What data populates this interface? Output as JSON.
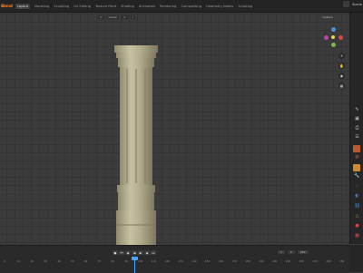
{
  "topbar": {
    "logo_label": "Blend",
    "tabs": [
      "Layout",
      "Modeling",
      "Sculpting",
      "UV Editing",
      "Texture Paint",
      "Shading",
      "Animation",
      "Rendering",
      "Compositing",
      "Geometry Nodes",
      "Scripting"
    ],
    "active_tab_index": 0,
    "scene_label": "Scene"
  },
  "viewport_header": {
    "mode_label": "Global",
    "options_label": "Options"
  },
  "timeline": {
    "ruler_ticks": [
      "0",
      "10",
      "20",
      "30",
      "40",
      "50",
      "60",
      "70",
      "80",
      "90",
      "100",
      "110",
      "120",
      "130",
      "140",
      "150",
      "160",
      "170",
      "180",
      "190",
      "200",
      "210",
      "220",
      "230",
      "240",
      "250"
    ],
    "start_label": "1",
    "end_label": "250",
    "current_frame_label": "1"
  },
  "colors": {
    "x_axis": "#e04343",
    "y_axis": "#7ab84a",
    "z_axis": "#4a8fe0",
    "accent": "#ff8a2a",
    "playhead": "#4aa3ff"
  }
}
